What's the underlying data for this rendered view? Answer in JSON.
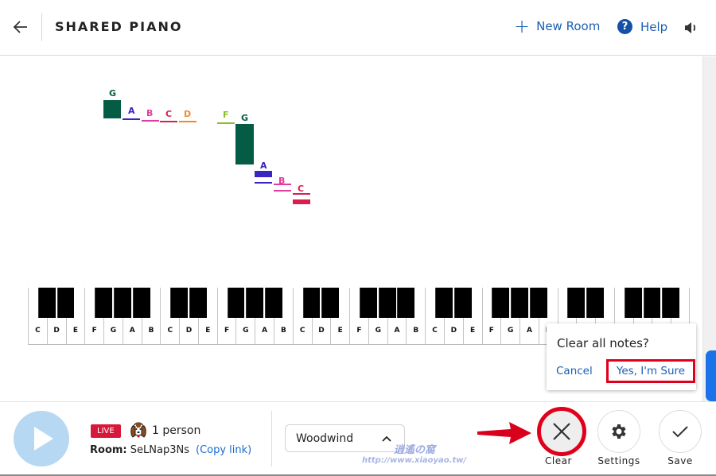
{
  "header": {
    "back_icon": "arrow-left-icon",
    "title": "SHARED PIANO",
    "new_room_label": "New Room",
    "new_room_icon": "plus-icon",
    "help_label": "Help",
    "help_icon": "question-circle-icon",
    "help_glyph": "?",
    "volume_icon": "speaker-icon"
  },
  "notes": [
    {
      "pitch": "G",
      "color": "#045c45",
      "group": 1,
      "style": "block"
    },
    {
      "pitch": "A",
      "color": "#3b25c2",
      "group": 1,
      "style": "line"
    },
    {
      "pitch": "B",
      "color": "#e53aa0",
      "group": 1,
      "style": "line"
    },
    {
      "pitch": "C",
      "color": "#d91e4b",
      "group": 1,
      "style": "line"
    },
    {
      "pitch": "D",
      "color": "#f0892e",
      "group": 1,
      "style": "line"
    },
    {
      "pitch": "F",
      "color": "#8bbd2a",
      "group": 2,
      "style": "line"
    },
    {
      "pitch": "G",
      "color": "#045c45",
      "group": 2,
      "style": "block"
    },
    {
      "pitch": "A",
      "color": "#3b25c2",
      "group": 2,
      "style": "block"
    },
    {
      "pitch": "B",
      "color": "#e53aa0",
      "group": 2,
      "style": "line"
    },
    {
      "pitch": "C",
      "color": "#d91e4b",
      "group": 2,
      "style": "block"
    }
  ],
  "piano": {
    "octaves": 5,
    "white_labels": [
      "C",
      "D",
      "E",
      "F",
      "G",
      "A",
      "B"
    ]
  },
  "popup": {
    "title": "Clear all notes?",
    "cancel_label": "Cancel",
    "confirm_label": "Yes, I'm Sure"
  },
  "footer": {
    "play_icon": "play-icon",
    "live_label": "LIVE",
    "avatar_icon": "dog-avatar-icon",
    "person_count": "1 person",
    "room_label": "Room:",
    "room_code": "SeLNap3Ns",
    "copy_link_label": "(Copy link)",
    "instrument": "Woodwind",
    "instrument_icon": "chevron-up-icon",
    "clear_label": "Clear",
    "settings_label": "Settings",
    "save_label": "Save"
  },
  "watermark": {
    "line1": "逍遙の窩",
    "line2": "http://www.xiaoyao.tw/"
  },
  "colors": {
    "accent": "#1a5fb4",
    "live": "#d8183a",
    "highlight": "#e0001b",
    "play_button": "#b7d8f3",
    "scroll_thumb": "#1a73e8"
  }
}
